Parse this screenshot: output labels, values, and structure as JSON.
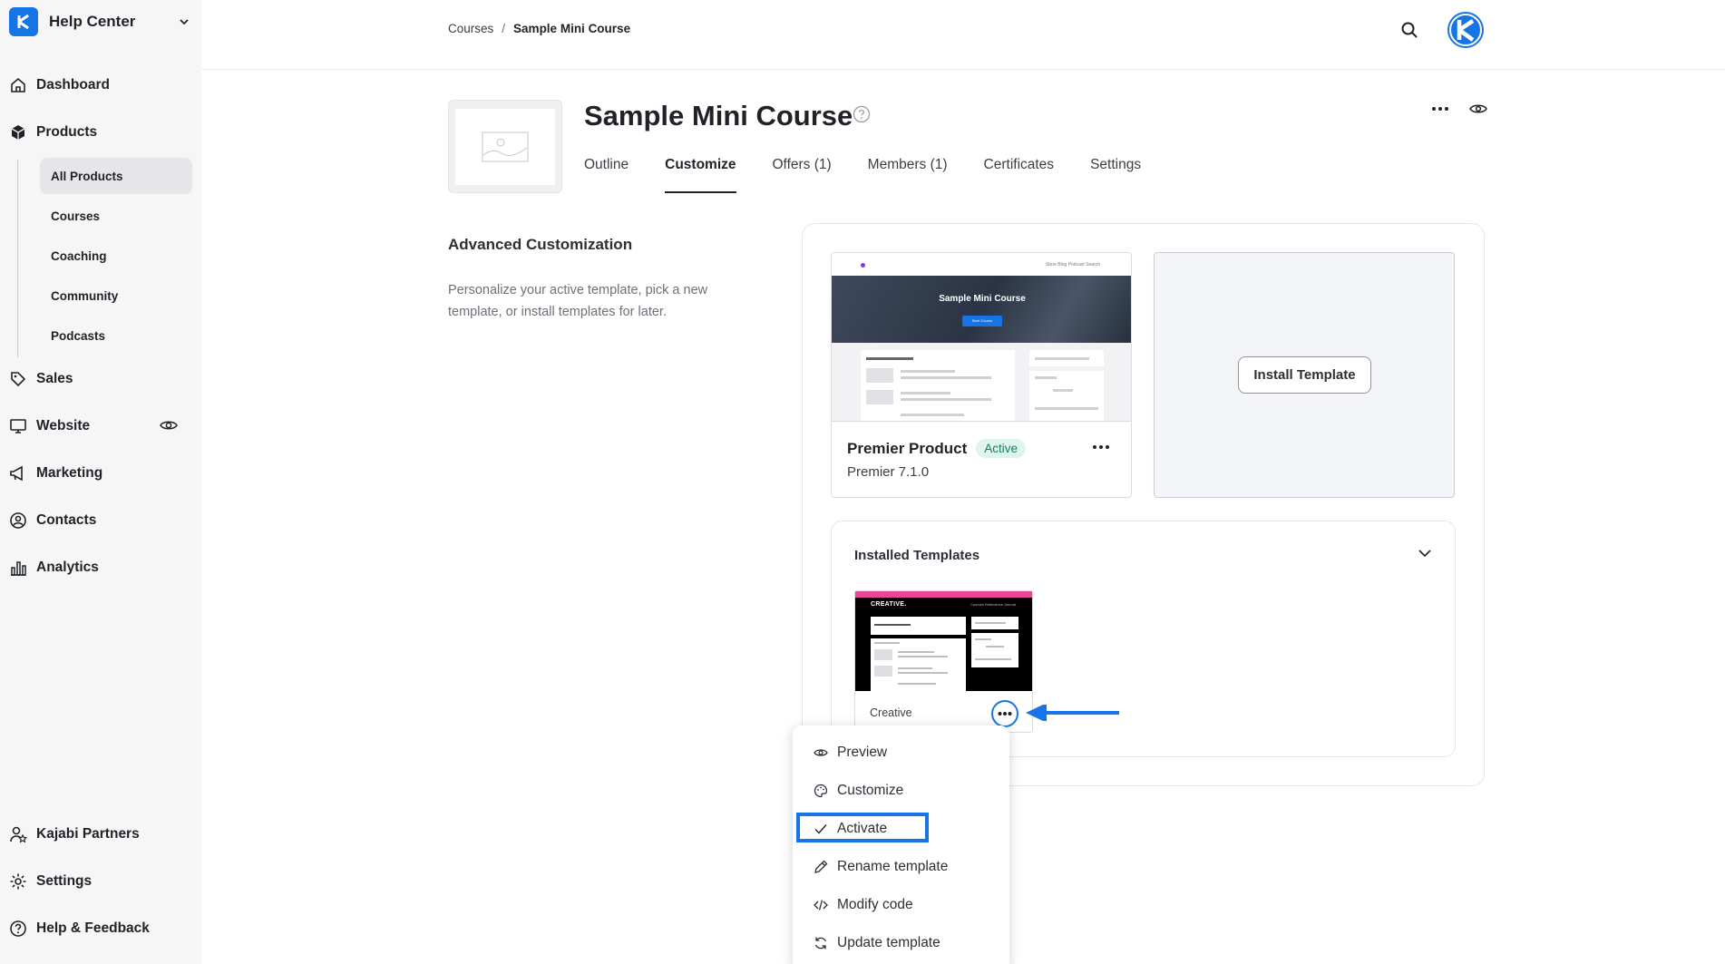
{
  "sidebar": {
    "brand": "Help Center",
    "nav": [
      {
        "label": "Dashboard",
        "icon": "home-icon"
      },
      {
        "label": "Products",
        "icon": "box-icon"
      },
      {
        "label": "Sales",
        "icon": "tag-icon"
      },
      {
        "label": "Website",
        "icon": "monitor-icon"
      },
      {
        "label": "Marketing",
        "icon": "megaphone-icon"
      },
      {
        "label": "Contacts",
        "icon": "at-sign-icon"
      },
      {
        "label": "Analytics",
        "icon": "bar-chart-icon"
      }
    ],
    "products_sub": [
      "All Products",
      "Courses",
      "Coaching",
      "Community",
      "Podcasts"
    ],
    "bottom": [
      {
        "label": "Kajabi Partners",
        "icon": "partner-icon"
      },
      {
        "label": "Settings",
        "icon": "gear-icon"
      },
      {
        "label": "Help & Feedback",
        "icon": "help-circle-icon"
      }
    ]
  },
  "breadcrumb": {
    "parent": "Courses",
    "separator": "/",
    "current": "Sample Mini Course"
  },
  "page": {
    "title": "Sample Mini Course",
    "tabs": [
      "Outline",
      "Customize",
      "Offers (1)",
      "Members (1)",
      "Certificates",
      "Settings"
    ],
    "active_tab": "Customize"
  },
  "customization": {
    "title": "Advanced Customization",
    "description": "Personalize your active template, pick a new template, or install templates for later."
  },
  "active_template": {
    "name": "Premier Product",
    "badge": "Active",
    "version": "Premier 7.1.0",
    "preview": {
      "nav_links": "Store   Blog   Podcast   Search",
      "hero_title": "Sample Mini Course",
      "hero_button": "Start Course"
    }
  },
  "install": {
    "button": "Install Template"
  },
  "installed": {
    "title": "Installed Templates",
    "templates": [
      {
        "name": "Creative",
        "preview_brand": "CREATIVE.",
        "preview_links": "Courses   Reflections   Journal"
      }
    ]
  },
  "menu": {
    "items": [
      {
        "label": "Preview",
        "icon": "eye-icon"
      },
      {
        "label": "Customize",
        "icon": "palette-icon"
      },
      {
        "label": "Activate",
        "icon": "check-icon"
      },
      {
        "label": "Rename template",
        "icon": "pencil-icon"
      },
      {
        "label": "Modify code",
        "icon": "code-icon"
      },
      {
        "label": "Update template",
        "icon": "refresh-icon"
      }
    ]
  },
  "colors": {
    "accent": "#1674e6",
    "active_badge_bg": "#dff5ec",
    "active_badge_text": "#16805a",
    "sidebar_bg": "#f6f6f7",
    "creative_pink": "#e6489b"
  }
}
